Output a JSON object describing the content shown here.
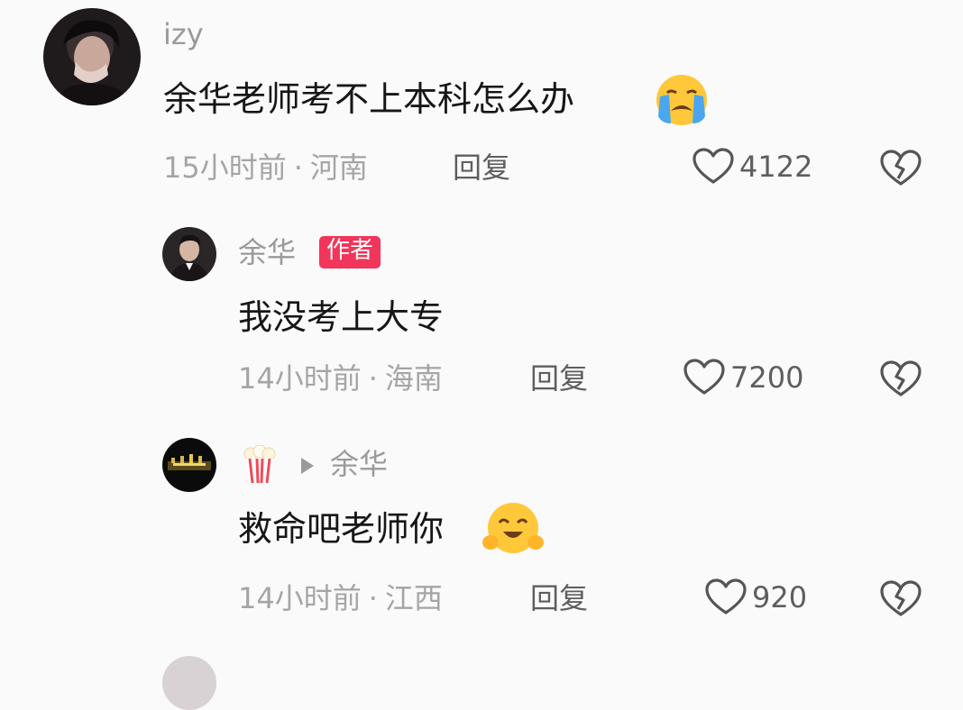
{
  "comments": [
    {
      "username": "izy",
      "text": "余华老师考不上本科怎么办",
      "emoji": "loudly-crying-face",
      "time": "15小时前",
      "location": "河南",
      "reply_label": "回复",
      "likes": "4122"
    },
    {
      "username": "余华",
      "badge": "作者",
      "text": "我没考上大专",
      "time": "14小时前",
      "location": "海南",
      "reply_label": "回复",
      "likes": "7200"
    },
    {
      "username_emoji": "popcorn",
      "reply_to": "余华",
      "text": "救命吧老师你",
      "emoji": "hugging-face",
      "time": "14小时前",
      "location": "江西",
      "reply_label": "回复",
      "likes": "920"
    }
  ],
  "colors": {
    "background": "#fafafa",
    "text": "#161616",
    "meta": "#a5a5a5",
    "badge": "#f2355a"
  }
}
